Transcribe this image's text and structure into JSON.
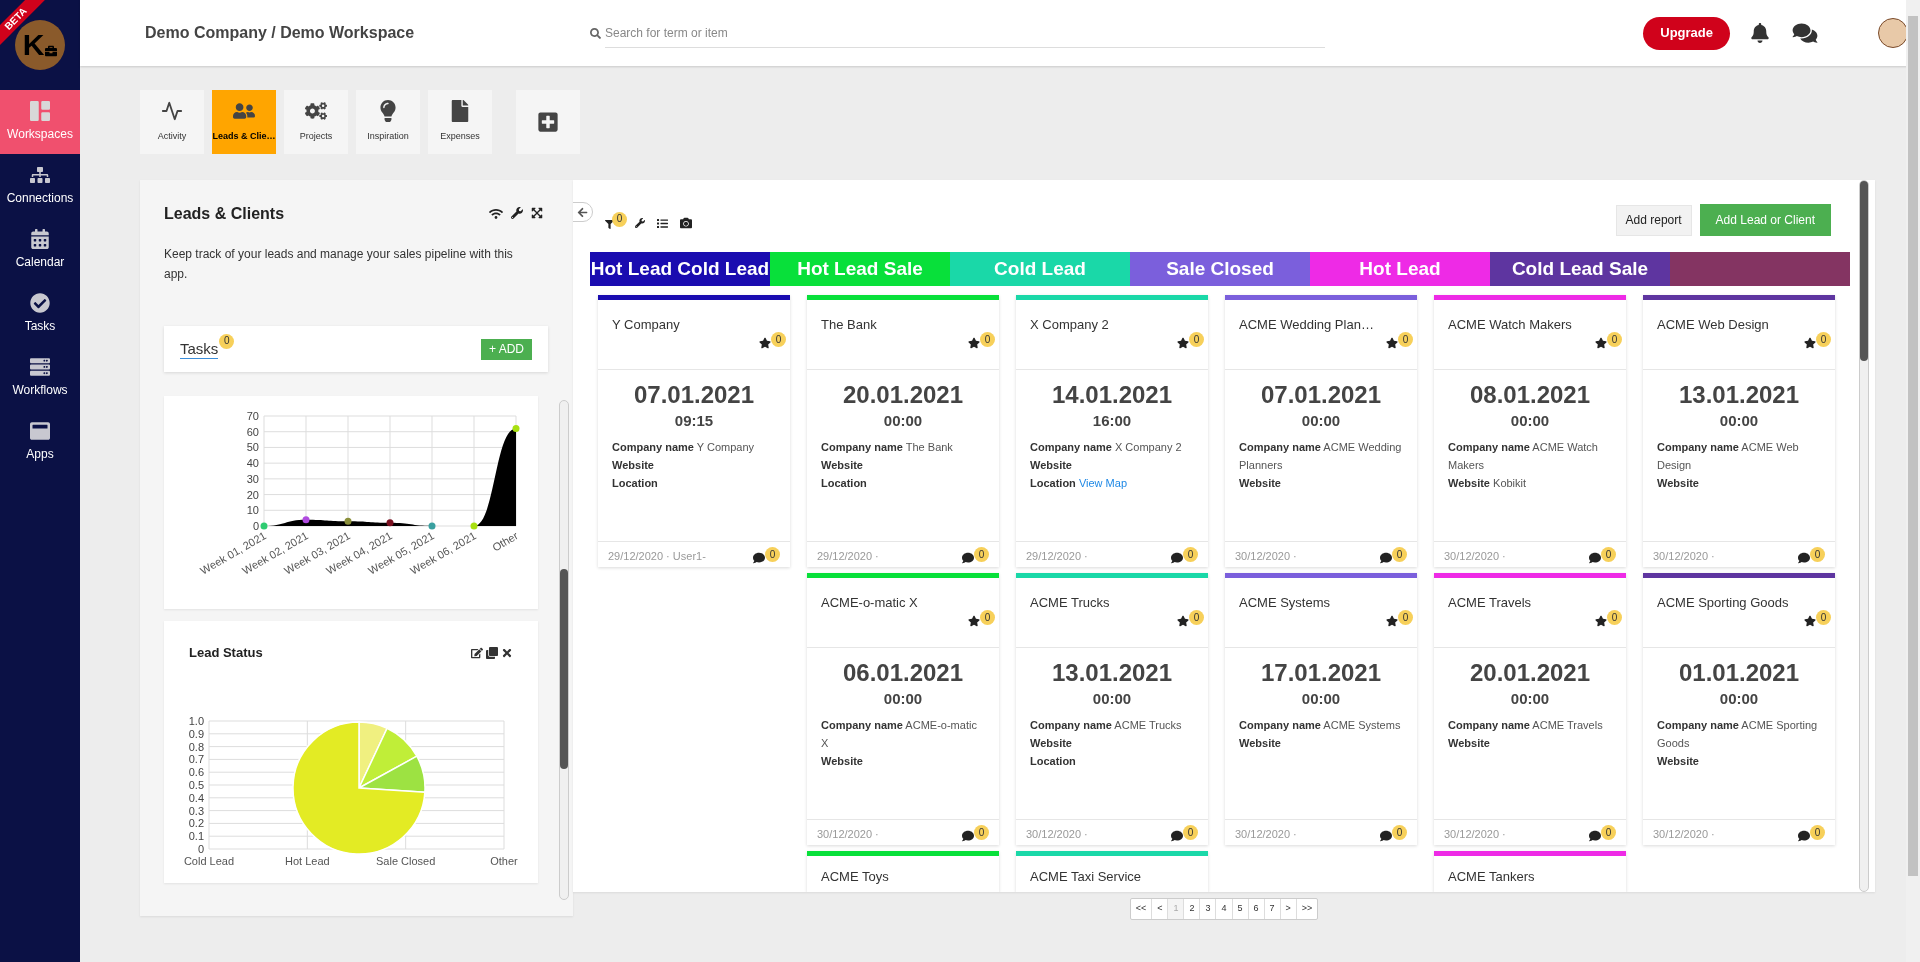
{
  "sidebar": {
    "logo_text": "K",
    "ribbon": "BETA",
    "items": [
      {
        "label": "Workspaces",
        "selected": true
      },
      {
        "label": "Connections",
        "selected": false
      },
      {
        "label": "Calendar",
        "selected": false
      },
      {
        "label": "Tasks",
        "selected": false
      },
      {
        "label": "Workflows",
        "selected": false
      },
      {
        "label": "Apps",
        "selected": false
      }
    ]
  },
  "header": {
    "breadcrumb": "Demo Company / Demo Workspace",
    "search": {
      "placeholder": "Search for term or item"
    },
    "upgrade_button": "Upgrade"
  },
  "app_tabs": [
    {
      "label": "Activity",
      "selected": false
    },
    {
      "label": "Leads & Clie…",
      "selected": true
    },
    {
      "label": "Projects",
      "selected": false
    },
    {
      "label": "Inspiration",
      "selected": false
    },
    {
      "label": "Expenses",
      "selected": false
    }
  ],
  "left_panel": {
    "title": "Leads & Clients",
    "description": "Keep track of your leads and manage your sales pipeline with this app.",
    "tasks": {
      "label": "Tasks",
      "count": "0",
      "add_button": "+ ADD"
    },
    "activity_chart": {
      "chart_data": {
        "type": "area",
        "categories": [
          "Week 01, 2021",
          "Week 02, 2021",
          "Week 03, 2021",
          "Week 04, 2021",
          "Week 05, 2021",
          "Week 06, 2021",
          "Other"
        ],
        "yticks": [
          0,
          10,
          20,
          30,
          40,
          50,
          60,
          70
        ],
        "ylim": [
          0,
          70
        ],
        "grid": true,
        "series": [
          {
            "color": "#000000",
            "values": [
              0,
              4,
              3,
              2,
              0,
              0,
              62
            ]
          }
        ]
      }
    },
    "lead_status": {
      "title": "Lead Status",
      "y_labels": [
        "1.0",
        "0.9",
        "0.8",
        "0.7",
        "0.6",
        "0.5",
        "0.4",
        "0.3",
        "0.2",
        "0.1",
        "0"
      ],
      "x_labels": [
        "Cold Lead",
        "Hot Lead",
        "Sale Closed",
        "Other"
      ]
    }
  },
  "board": {
    "filter_count": "0",
    "add_report_button": "Add report",
    "add_button": "Add Lead or Client",
    "status_headers": [
      {
        "label": "Hot Lead Cold Lead",
        "color": "#1a0cb0"
      },
      {
        "label": "Hot Lead Sale",
        "color": "#08e03a"
      },
      {
        "label": "Cold Lead",
        "color": "#1ad8a8"
      },
      {
        "label": "Sale Closed",
        "color": "#7b5fdc"
      },
      {
        "label": "Hot Lead",
        "color": "#ee2ae6"
      },
      {
        "label": "Cold Lead Sale",
        "color": "#5e35a0"
      },
      {
        "color": "#843462"
      }
    ],
    "columns": [
      {
        "cards": [
          {
            "kind": "full",
            "name": "Y Company",
            "color": "#1a0cb0",
            "stars": "0",
            "date": "07.01.2021",
            "time": "09:15",
            "fields": [
              {
                "label": "Company name",
                "value": "Y Company"
              },
              {
                "label": "Website"
              },
              {
                "label": "Location"
              }
            ],
            "footer": "29/12/2020 · User1-",
            "comments": "0"
          }
        ]
      },
      {
        "cards": [
          {
            "kind": "full",
            "name": "The Bank",
            "color": "#08e03a",
            "stars": "0",
            "date": "20.01.2021",
            "time": "00:00",
            "fields": [
              {
                "label": "Company name",
                "value": "The Bank"
              },
              {
                "label": "Website"
              },
              {
                "label": "Location"
              }
            ],
            "footer": "29/12/2020 ·",
            "comments": "0"
          },
          {
            "kind": "full",
            "name": "ACME-o-matic X",
            "color": "#08e03a",
            "stars": "0",
            "date": "06.01.2021",
            "time": "00:00",
            "fields": [
              {
                "label": "Company name",
                "value": "ACME-o-matic X"
              },
              {
                "label": "Website"
              }
            ],
            "footer": "30/12/2020 ·",
            "comments": "0"
          },
          {
            "kind": "stub",
            "name": "ACME Toys",
            "color": "#08e03a"
          }
        ]
      },
      {
        "cards": [
          {
            "kind": "full",
            "name": "X Company 2",
            "color": "#1ad8a8",
            "stars": "0",
            "date": "14.01.2021",
            "time": "16:00",
            "fields": [
              {
                "label": "Company name",
                "value": "X Company 2"
              },
              {
                "label": "Website"
              },
              {
                "label": "Location",
                "link": "View Map"
              }
            ],
            "footer": "29/12/2020 ·",
            "comments": "0"
          },
          {
            "kind": "full",
            "name": "ACME Trucks",
            "color": "#1ad8a8",
            "stars": "0",
            "date": "13.01.2021",
            "time": "00:00",
            "fields": [
              {
                "label": "Company name",
                "value": "ACME Trucks"
              },
              {
                "label": "Website"
              },
              {
                "label": "Location"
              }
            ],
            "footer": "30/12/2020 ·",
            "comments": "0"
          },
          {
            "kind": "stub",
            "name": "ACME Taxi Service",
            "color": "#1ad8a8"
          }
        ]
      },
      {
        "cards": [
          {
            "kind": "full",
            "name": "ACME Wedding Plan…",
            "color": "#7b5fdc",
            "stars": "0",
            "date": "07.01.2021",
            "time": "00:00",
            "fields": [
              {
                "label": "Company name",
                "value": "ACME Wedding Planners"
              },
              {
                "label": "Website"
              }
            ],
            "footer": "30/12/2020 ·",
            "comments": "0"
          },
          {
            "kind": "full",
            "name": "ACME Systems",
            "color": "#7b5fdc",
            "stars": "0",
            "date": "17.01.2021",
            "time": "00:00",
            "fields": [
              {
                "label": "Company name",
                "value": "ACME Systems"
              },
              {
                "label": "Website"
              }
            ],
            "footer": "30/12/2020 ·",
            "comments": "0"
          }
        ]
      },
      {
        "cards": [
          {
            "kind": "full",
            "name": "ACME Watch Makers",
            "color": "#ee2ae6",
            "stars": "0",
            "date": "08.01.2021",
            "time": "00:00",
            "fields": [
              {
                "label": "Company name",
                "value": "ACME Watch Makers"
              },
              {
                "label": "Website",
                "value": "Kobikit"
              }
            ],
            "footer": "30/12/2020 ·",
            "comments": "0"
          },
          {
            "kind": "full",
            "name": "ACME Travels",
            "color": "#ee2ae6",
            "stars": "0",
            "date": "20.01.2021",
            "time": "00:00",
            "fields": [
              {
                "label": "Company name",
                "value": "ACME Travels"
              },
              {
                "label": "Website"
              }
            ],
            "footer": "30/12/2020 ·",
            "comments": "0"
          },
          {
            "kind": "stub",
            "name": "ACME Tankers",
            "color": "#ee2ae6"
          }
        ]
      },
      {
        "cards": [
          {
            "kind": "full",
            "name": "ACME Web Design",
            "color": "#5e35a0",
            "stars": "0",
            "date": "13.01.2021",
            "time": "00:00",
            "fields": [
              {
                "label": "Company name",
                "value": "ACME Web Design"
              },
              {
                "label": "Website"
              }
            ],
            "footer": "30/12/2020 ·",
            "comments": "0"
          },
          {
            "kind": "full",
            "name": "ACME Sporting Goods",
            "color": "#5e35a0",
            "stars": "0",
            "date": "01.01.2021",
            "time": "00:00",
            "fields": [
              {
                "label": "Company name",
                "value": "ACME Sporting Goods"
              },
              {
                "label": "Website"
              }
            ],
            "footer": "30/12/2020 ·",
            "comments": "0"
          }
        ]
      }
    ]
  },
  "pagination": [
    {
      "label": "<<",
      "selected": false
    },
    {
      "label": "<",
      "selected": false
    },
    {
      "label": "1",
      "selected": true
    },
    {
      "label": "2",
      "selected": false
    },
    {
      "label": "3",
      "selected": false
    },
    {
      "label": "4",
      "selected": false
    },
    {
      "label": "5",
      "selected": false
    },
    {
      "label": "6",
      "selected": false
    },
    {
      "label": "7",
      "selected": false
    },
    {
      "label": ">",
      "selected": false
    },
    {
      "label": ">>",
      "selected": false
    }
  ]
}
